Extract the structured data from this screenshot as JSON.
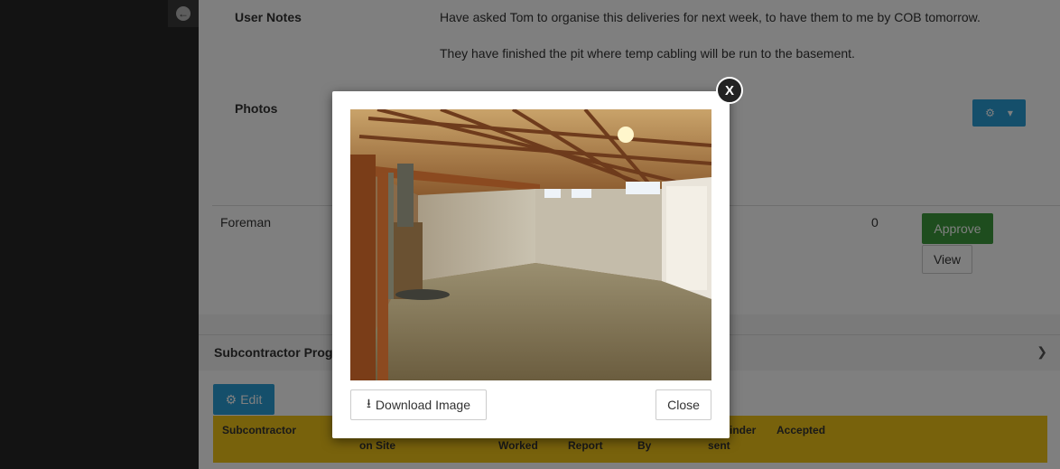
{
  "user_notes": {
    "label": "User Notes",
    "line1": "Have asked Tom to organise this deliveries for next week, to have them to me by COB tomorrow.",
    "line2": "They have finished the pit where temp cabling will be run to the basement."
  },
  "photos": {
    "label": "Photos"
  },
  "foreman_row": {
    "role": "Foreman",
    "count": "0",
    "approve_label": "Approve",
    "view_label": "View"
  },
  "subcontractor_panel": {
    "title": "Subcontractor Prog",
    "edit_label": "Edit",
    "columns": [
      "Subcontractor",
      "on Site",
      "Worked",
      "Report",
      "By",
      "inder",
      "sent",
      "Accepted"
    ]
  },
  "modal": {
    "close_x": "X",
    "download_label": "Download Image",
    "close_label": "Close"
  },
  "colors": {
    "primary": "#2a9fd6",
    "success": "#3c9a3c",
    "table_header": "#f0c419"
  }
}
